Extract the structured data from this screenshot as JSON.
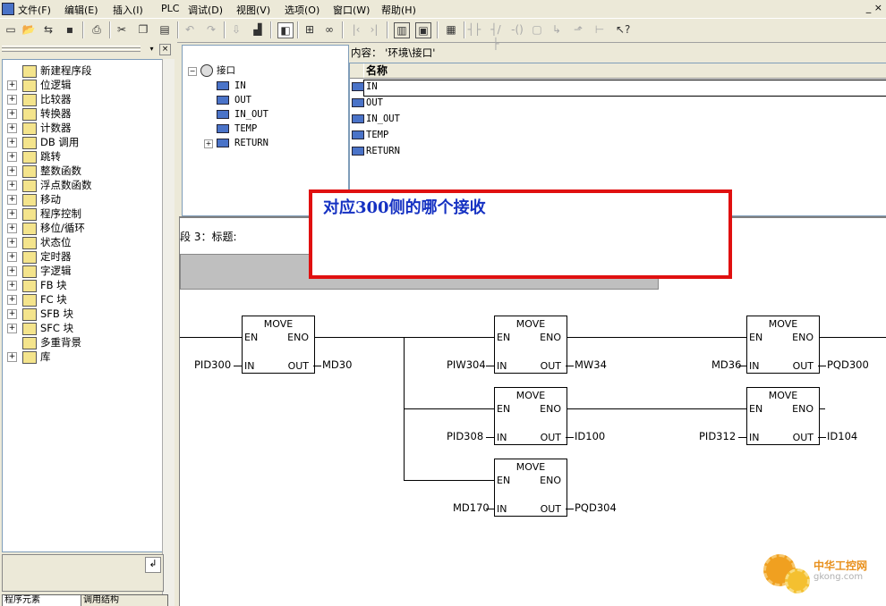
{
  "menubar": {
    "items": [
      "文件(F)",
      "编辑(E)",
      "插入(I)",
      "PLC",
      "调试(D)",
      "视图(V)",
      "选项(O)",
      "窗口(W)",
      "帮助(H)"
    ],
    "window_controls": "_ ×"
  },
  "left_panel": {
    "tree": [
      {
        "label": "新建程序段",
        "icon": "new-network-icon",
        "expand": ""
      },
      {
        "label": "位逻辑",
        "icon": "bit-logic-icon",
        "expand": "+"
      },
      {
        "label": "比较器",
        "icon": "comparator-icon",
        "expand": "+"
      },
      {
        "label": "转换器",
        "icon": "converter-icon",
        "expand": "+"
      },
      {
        "label": "计数器",
        "icon": "counter-icon",
        "expand": "+"
      },
      {
        "label": "DB 调用",
        "icon": "db-call-icon",
        "expand": "+"
      },
      {
        "label": "跳转",
        "icon": "jump-icon",
        "expand": "+"
      },
      {
        "label": "整数函数",
        "icon": "integer-math-icon",
        "expand": "+"
      },
      {
        "label": "浮点数函数",
        "icon": "float-math-icon",
        "expand": "+"
      },
      {
        "label": "移动",
        "icon": "move-icon",
        "expand": "+"
      },
      {
        "label": "程序控制",
        "icon": "program-control-icon",
        "expand": "+"
      },
      {
        "label": "移位/循环",
        "icon": "shift-rotate-icon",
        "expand": "+"
      },
      {
        "label": "状态位",
        "icon": "status-bit-icon",
        "expand": "+"
      },
      {
        "label": "定时器",
        "icon": "timer-icon",
        "expand": "+"
      },
      {
        "label": "字逻辑",
        "icon": "word-logic-icon",
        "expand": "+"
      },
      {
        "label": "FB 块",
        "icon": "fb-block-icon",
        "expand": "+"
      },
      {
        "label": "FC 块",
        "icon": "fc-block-icon",
        "expand": "+"
      },
      {
        "label": "SFB 块",
        "icon": "sfb-block-icon",
        "expand": "+"
      },
      {
        "label": "SFC 块",
        "icon": "sfc-block-icon",
        "expand": "+"
      },
      {
        "label": "多重背景",
        "icon": "multi-instance-icon",
        "expand": ""
      },
      {
        "label": "库",
        "icon": "library-icon",
        "expand": "+"
      }
    ],
    "tabs": [
      "程序元素",
      "调用结构"
    ]
  },
  "interface_tree": {
    "root": "接口",
    "items": [
      "IN",
      "OUT",
      "IN_OUT",
      "TEMP",
      "RETURN"
    ]
  },
  "content": {
    "header": "内容： '环境\\接口'",
    "column_name": "名称",
    "rows": [
      "IN",
      "OUT",
      "IN_OUT",
      "TEMP",
      "RETURN"
    ]
  },
  "program": {
    "network_title": "段 3：标题:",
    "blocks": [
      {
        "title": "MOVE",
        "en": "EN",
        "eno": "ENO",
        "in_pin": "IN",
        "out_pin": "OUT",
        "input": "PID300",
        "output": "MD30"
      },
      {
        "title": "MOVE",
        "en": "EN",
        "eno": "ENO",
        "in_pin": "IN",
        "out_pin": "OUT",
        "input": "PIW304",
        "output": "MW34"
      },
      {
        "title": "MOVE",
        "en": "EN",
        "eno": "ENO",
        "in_pin": "IN",
        "out_pin": "OUT",
        "input": "MD36",
        "output": "PQD300"
      },
      {
        "title": "MOVE",
        "en": "EN",
        "eno": "ENO",
        "in_pin": "IN",
        "out_pin": "OUT",
        "input": "PID308",
        "output": "ID100"
      },
      {
        "title": "MOVE",
        "en": "EN",
        "eno": "ENO",
        "in_pin": "IN",
        "out_pin": "OUT",
        "input": "PID312",
        "output": "ID104"
      },
      {
        "title": "MOVE",
        "en": "EN",
        "eno": "ENO",
        "in_pin": "IN",
        "out_pin": "OUT",
        "input": "MD170",
        "output": "PQD304"
      }
    ]
  },
  "annotation": {
    "text": "对应300侧的哪个接收",
    "border_color": "#e01010",
    "text_color": "#1531c2"
  },
  "watermark": {
    "title": "中华工控网",
    "url": "gkong.com"
  }
}
